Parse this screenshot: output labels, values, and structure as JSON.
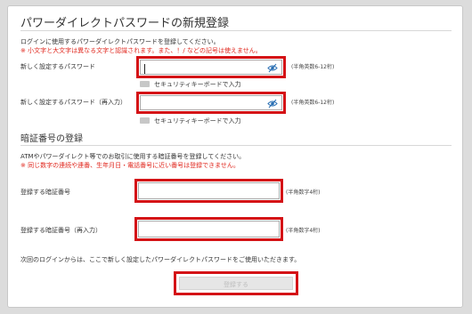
{
  "password_section": {
    "title": "パワーダイレクトパスワードの新規登録",
    "description": "ログインに使用するパワーダイレクトパスワードを登録してください。",
    "warning": "※ 小文字と大文字は異なる文字と認識されます。また、！/ などの記号は使えません。",
    "new_password": {
      "label": "新しく設定するパスワード",
      "note": "(半角英数6-12桁)",
      "value": "",
      "keyboard_label": "セキュリティキーボードで入力"
    },
    "confirm_password": {
      "label": "新しく設定するパスワード（再入力）",
      "note": "(半角英数6-12桁)",
      "value": "",
      "keyboard_label": "セキュリティキーボードで入力"
    }
  },
  "pin_section": {
    "title": "暗証番号の登録",
    "description": "ATMやパワーダイレクト等でのお取引に使用する暗証番号を登録してください。",
    "warning": "※ 同じ数字の連続や連番、生年月日・電話番号に近い番号は登録できません。",
    "pin": {
      "label": "登録する暗証番号",
      "note": "(半角数字4桁)",
      "value": ""
    },
    "confirm_pin": {
      "label": "登録する暗証番号（再入力）",
      "note": "(半角数字4桁)",
      "value": ""
    }
  },
  "footer": {
    "notice": "次回のログインからは、ここで新しく設定したパワーダイレクトパスワードをご使用いただきます。",
    "submit_label": "登録する"
  },
  "colors": {
    "highlight": "#d41216",
    "warning_text": "#e0261c",
    "eye_icon": "#2a6fb3"
  }
}
